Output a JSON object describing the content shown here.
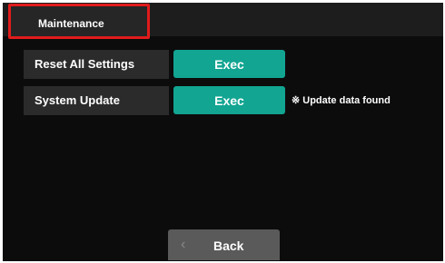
{
  "header": {
    "tab_label": "Maintenance"
  },
  "rows": [
    {
      "label": "Reset All Settings",
      "button_label": "Exec",
      "note": ""
    },
    {
      "label": "System Update",
      "button_label": "Exec",
      "note": "※ Update data found"
    }
  ],
  "footer": {
    "back_label": "Back",
    "back_icon": "chevron-left-icon"
  },
  "colors": {
    "accent": "#12a592",
    "highlight_border": "#e01b1b",
    "background": "#0c0c0c"
  }
}
